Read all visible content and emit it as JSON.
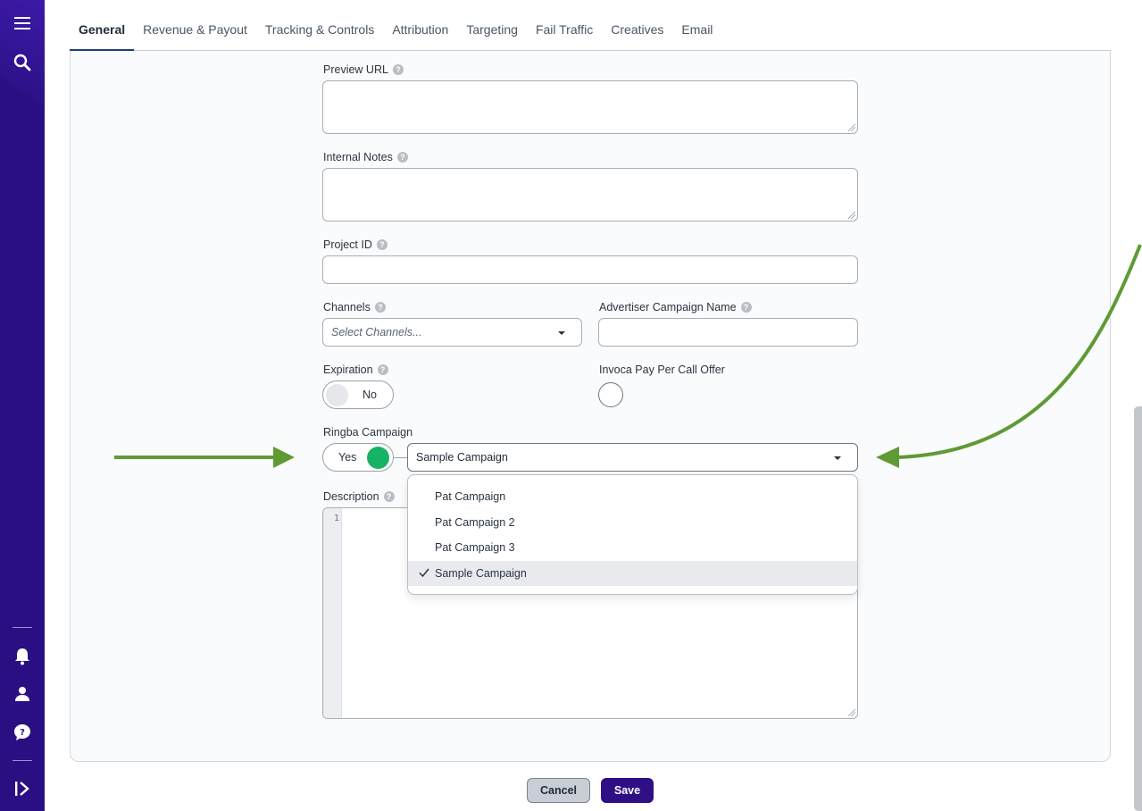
{
  "tabs": [
    {
      "label": "General",
      "active": true
    },
    {
      "label": "Revenue & Payout",
      "active": false
    },
    {
      "label": "Tracking & Controls",
      "active": false
    },
    {
      "label": "Attribution",
      "active": false
    },
    {
      "label": "Targeting",
      "active": false
    },
    {
      "label": "Fail Traffic",
      "active": false
    },
    {
      "label": "Creatives",
      "active": false
    },
    {
      "label": "Email",
      "active": false
    }
  ],
  "form": {
    "preview_url": {
      "label": "Preview URL",
      "value": ""
    },
    "internal_notes": {
      "label": "Internal Notes",
      "value": ""
    },
    "project_id": {
      "label": "Project ID",
      "value": ""
    },
    "channels": {
      "label": "Channels",
      "placeholder": "Select Channels..."
    },
    "advertiser_campaign_name": {
      "label": "Advertiser Campaign Name",
      "value": ""
    },
    "expiration": {
      "label": "Expiration",
      "toggle_text": "No",
      "enabled": false
    },
    "invoca_pay_per_call": {
      "label": "Invoca Pay Per Call Offer",
      "checked": false
    },
    "ringba_campaign": {
      "label": "Ringba Campaign",
      "toggle_text": "Yes",
      "enabled": true,
      "selected": "Sample Campaign",
      "options": [
        "Pat Campaign",
        "Pat Campaign 2",
        "Pat Campaign 3",
        "Sample Campaign"
      ]
    },
    "description": {
      "label": "Description",
      "line_number": "1"
    }
  },
  "actions": {
    "cancel_label": "Cancel",
    "save_label": "Save"
  },
  "colors": {
    "rail": "#2a0f82",
    "toggle_on": "#16b364",
    "toggle_off": "#e5e7eb",
    "annotation_arrow": "#5f9a35",
    "save_button": "#2e0f86"
  },
  "icons": {
    "rail_top": [
      "menu-icon",
      "search-icon"
    ],
    "rail_bottom": [
      "bell-icon",
      "user-icon",
      "help-icon",
      "expand-icon"
    ]
  }
}
